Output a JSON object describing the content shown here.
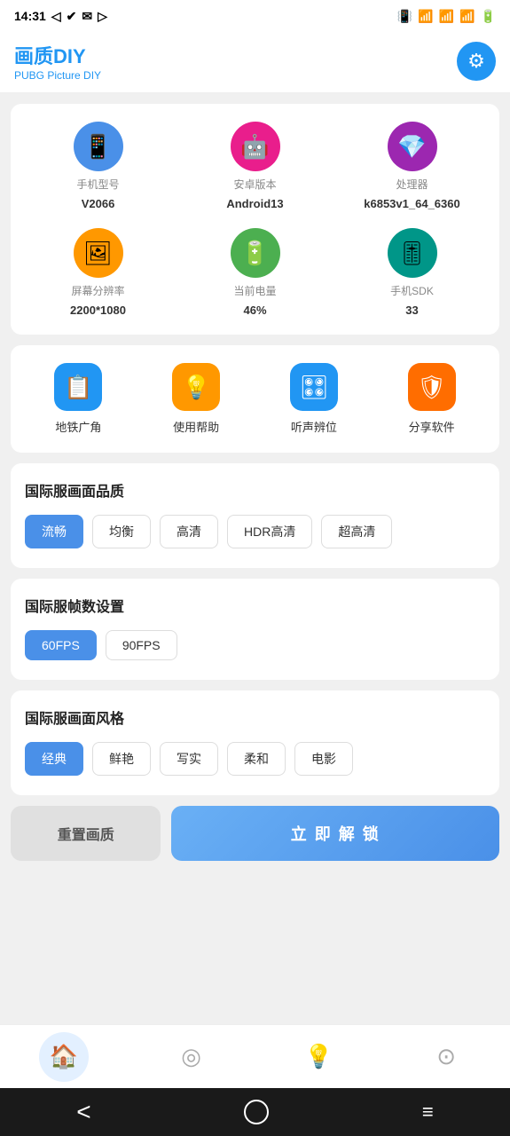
{
  "statusBar": {
    "time": "14:31",
    "icons": [
      "navigation",
      "check-circle",
      "email",
      "play-circle"
    ]
  },
  "header": {
    "title": "画质DIY",
    "subtitle": "PUBG Picture DIY",
    "settingsLabel": "settings"
  },
  "deviceInfo": {
    "items": [
      {
        "id": "phone-model",
        "label": "手机型号",
        "value": "V2066",
        "icon": "📱",
        "color": "#4A90E8"
      },
      {
        "id": "android-version",
        "label": "安卓版本",
        "value": "Android13",
        "icon": "🤖",
        "color": "#E91E8C"
      },
      {
        "id": "processor",
        "label": "处理器",
        "value": "k6853v1_64_6360",
        "icon": "🔲",
        "color": "#9C27B0"
      },
      {
        "id": "resolution",
        "label": "屏幕分辨率",
        "value": "2200*1080",
        "icon": "🖼",
        "color": "#FF9800"
      },
      {
        "id": "battery",
        "label": "当前电量",
        "value": "46%",
        "icon": "🔋",
        "color": "#4CAF50"
      },
      {
        "id": "sdk",
        "label": "手机SDK",
        "value": "33",
        "icon": "🎚",
        "color": "#009688"
      }
    ]
  },
  "quickActions": {
    "items": [
      {
        "id": "metro-corner",
        "label": "地铁广角",
        "icon": "📋",
        "color": "#2196F3"
      },
      {
        "id": "use-help",
        "label": "使用帮助",
        "icon": "💡",
        "color": "#FF9800"
      },
      {
        "id": "audio-position",
        "label": "听声辨位",
        "icon": "🎛",
        "color": "#2196F3"
      },
      {
        "id": "share-software",
        "label": "分享软件",
        "icon": "🛡",
        "color": "#FF6D00"
      }
    ]
  },
  "sections": {
    "quality": {
      "title": "国际服画面品质",
      "options": [
        "流畅",
        "均衡",
        "高清",
        "HDR高清",
        "超高清"
      ],
      "activeIndex": 0
    },
    "fps": {
      "title": "国际服帧数设置",
      "options": [
        "60FPS",
        "90FPS"
      ],
      "activeIndex": 0
    },
    "style": {
      "title": "国际服画面风格",
      "options": [
        "经典",
        "鲜艳",
        "写实",
        "柔和",
        "电影"
      ],
      "activeIndex": 0
    }
  },
  "bottomActions": {
    "resetLabel": "重置画质",
    "unlockLabel": "立 即 解 锁"
  },
  "bottomNav": {
    "items": [
      {
        "id": "home",
        "icon": "🏠",
        "active": true
      },
      {
        "id": "compass",
        "icon": "🧭",
        "active": false
      },
      {
        "id": "bulb",
        "icon": "💡",
        "active": false
      },
      {
        "id": "circle-dot",
        "icon": "⊙",
        "active": false
      }
    ]
  },
  "sysNav": {
    "back": "‹",
    "home": "○",
    "menu": "≡"
  }
}
